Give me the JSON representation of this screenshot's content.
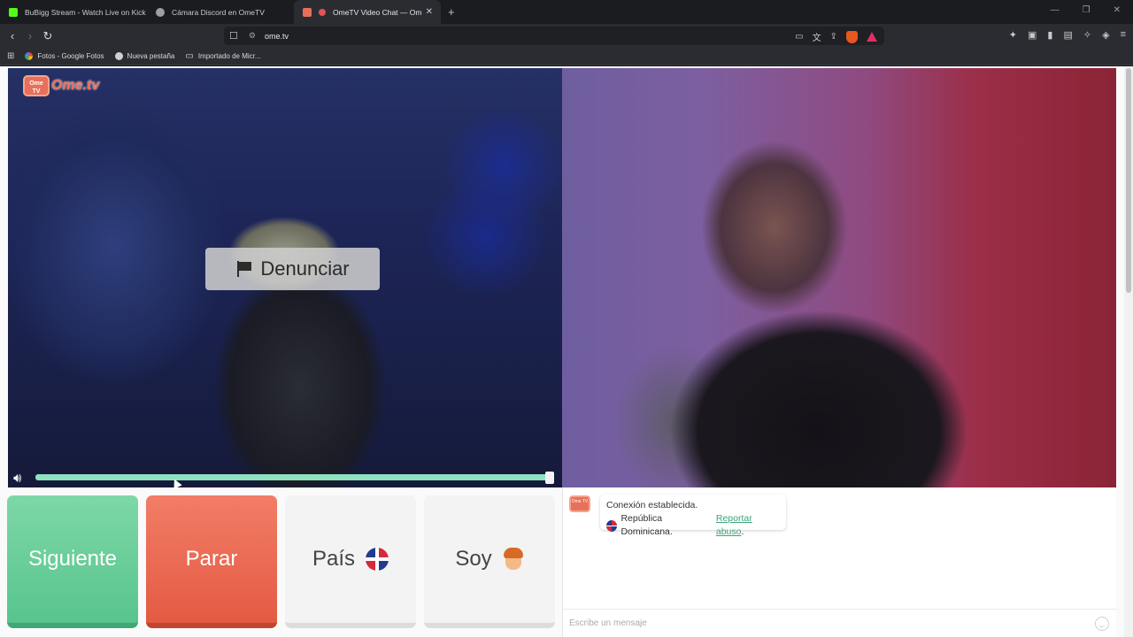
{
  "tabs": [
    {
      "title": "BuBigg Stream - Watch Live on Kick",
      "favicon_color": "#53fc18"
    },
    {
      "title": "Cámara Discord en OmeTV",
      "favicon_color": "#9aa0a6"
    },
    {
      "title": "OmeTV Video Chat — Omegle",
      "favicon_color": "#e8705a"
    }
  ],
  "new_tab": "+",
  "address": {
    "url": "ome.tv"
  },
  "bookmarks": [
    {
      "label": "Fotos - Google Fotos",
      "icon": "google-photos-icon"
    },
    {
      "label": "Nueva pestaña",
      "icon": "globe-icon"
    },
    {
      "label": "Importado de Micr...",
      "icon": "folder-icon"
    }
  ],
  "site": {
    "logo_tv": "Ome TV",
    "logo_text": "Ome.tv",
    "report_label": "Denunciar"
  },
  "controls": {
    "next_label": "Siguiente",
    "stop_label": "Parar",
    "country_label": "País",
    "gender_label": "Soy",
    "volume_level": 1.0
  },
  "chat": {
    "logo_text": "Ome TV",
    "status_text": "Conexión establecida.",
    "country_text": "República Dominicana.",
    "report_link": "Reportar abuso",
    "report_suffix": ".",
    "input_placeholder": "Escribe un mensaje"
  },
  "colors": {
    "next": "#58c58d",
    "stop": "#e45a43",
    "accent": "#3aa57a",
    "brand": "#e8705a"
  }
}
